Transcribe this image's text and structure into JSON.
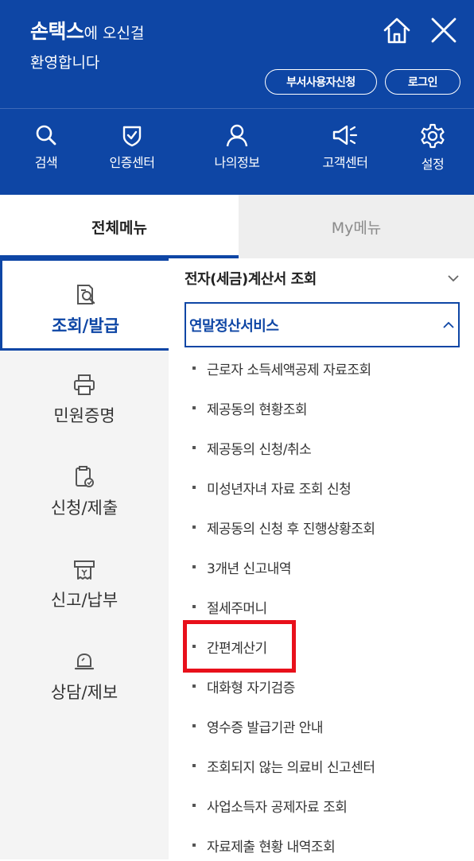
{
  "header": {
    "brand": "손택스",
    "welcome_suffix": "에 오신걸",
    "welcome_line2": "환영합니다",
    "home_icon": "home-icon",
    "close_icon": "close-icon",
    "dept_user_label": "부서사용자신청",
    "login_label": "로그인",
    "background_color": "#0e46a5"
  },
  "shortcuts": [
    {
      "label": "검색",
      "icon": "search-icon"
    },
    {
      "label": "인증센터",
      "icon": "shield-icon"
    },
    {
      "label": "나의정보",
      "icon": "user-icon"
    },
    {
      "label": "고객센터",
      "icon": "megaphone-icon"
    },
    {
      "label": "설정",
      "icon": "gear-icon"
    }
  ],
  "tabs": {
    "all_menu": "전체메뉴",
    "my_menu": "My메뉴",
    "active": "전체메뉴"
  },
  "categories": [
    {
      "label": "조회/발급",
      "icon": "document-search-icon",
      "active": true
    },
    {
      "label": "민원증명",
      "icon": "printer-icon",
      "active": false
    },
    {
      "label": "신청/제출",
      "icon": "clipboard-icon",
      "active": false
    },
    {
      "label": "신고/납부",
      "icon": "receipt-icon",
      "active": false
    },
    {
      "label": "상담/제보",
      "icon": "bell-icon",
      "active": false
    }
  ],
  "sections": [
    {
      "title": "전자(세금)계산서 조회",
      "expanded": false
    },
    {
      "title": "연말정산서비스",
      "expanded": true
    }
  ],
  "sub_items": [
    "근로자 소득세액공제 자료조회",
    "제공동의 현황조회",
    "제공동의 신청/취소",
    "미성년자녀 자료 조회 신청",
    "제공동의 신청 후 진행상황조회",
    "3개년 신고내역",
    "절세주머니",
    "간편계산기",
    "대화형 자기검증",
    "영수증 발급기관 안내",
    "조회되지 않는 의료비 신고센터",
    "사업소득자 공제자료 조회",
    "자료제출 현황 내역조회"
  ],
  "highlighted_item": "간편계산기",
  "colors": {
    "accent": "#0e46a5",
    "highlight": "#e8101b"
  }
}
